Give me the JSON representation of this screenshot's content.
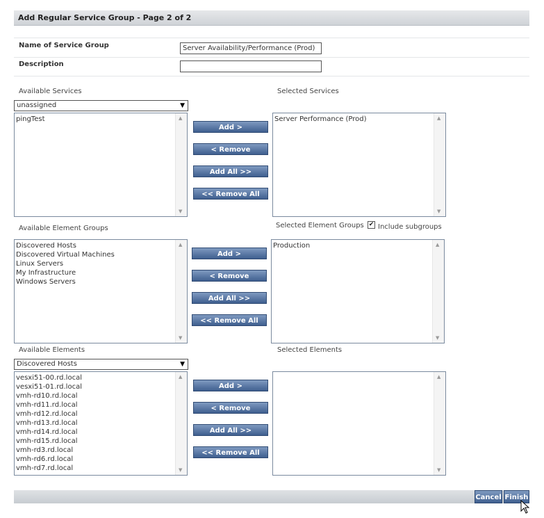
{
  "header": {
    "title": "Add Regular Service Group - Page 2 of 2"
  },
  "form": {
    "name_label": "Name of Service Group",
    "name_value": "Server Availability/Performance (Prod)",
    "description_label": "Description",
    "description_value": ""
  },
  "services": {
    "available_label": "Available Services",
    "selected_label": "Selected Services",
    "filter_value": "unassigned",
    "available_items": [
      "pingTest"
    ],
    "selected_items": [
      "Server Performance (Prod)"
    ]
  },
  "element_groups": {
    "available_label": "Available Element Groups",
    "selected_label": "Selected Element Groups",
    "include_subgroups_label": "Include subgroups",
    "include_subgroups_checked": "✔",
    "available_items": [
      "Discovered Hosts",
      "Discovered Virtual Machines",
      "Linux Servers",
      "My Infrastructure",
      "Windows Servers"
    ],
    "selected_items": [
      "Production"
    ]
  },
  "elements": {
    "available_label": "Available Elements",
    "selected_label": "Selected Elements",
    "filter_value": "Discovered Hosts",
    "available_items": [
      "vesxi51-00.rd.local",
      "vesxi51-01.rd.local",
      "vmh-rd10.rd.local",
      "vmh-rd11.rd.local",
      "vmh-rd12.rd.local",
      "vmh-rd13.rd.local",
      "vmh-rd14.rd.local",
      "vmh-rd15.rd.local",
      "vmh-rd3.rd.local",
      "vmh-rd6.rd.local",
      "vmh-rd7.rd.local"
    ],
    "selected_items": []
  },
  "buttons": {
    "add": "Add >",
    "remove": "< Remove",
    "add_all": "Add All >>",
    "remove_all": "<< Remove All",
    "cancel": "Cancel",
    "finish": "Finish"
  },
  "icons": {
    "dropdown": "▼",
    "scroll_up": "▲",
    "scroll_down": "▼"
  }
}
